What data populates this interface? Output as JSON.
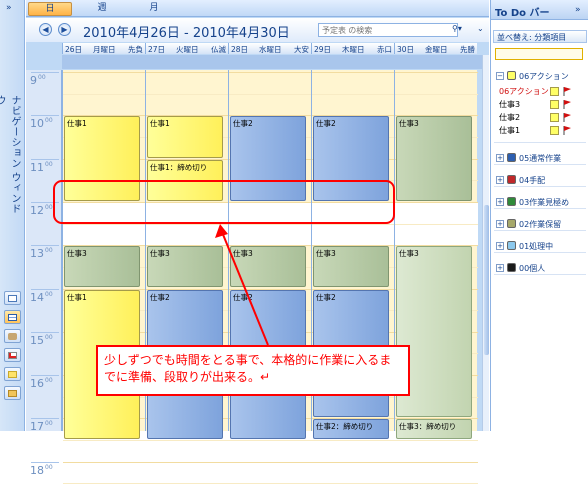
{
  "nav": {
    "label": "ナビゲーション ウィンドウ",
    "chevron": "»",
    "buttons": [
      "mail-icon",
      "calendar-icon",
      "contacts-icon",
      "tasks-icon",
      "notes-icon",
      "folder-icon"
    ]
  },
  "view_tabs": [
    "日",
    "週",
    "月"
  ],
  "active_tab": "週",
  "date_range": "2010年4月26日 - 2010年4月30日",
  "search": {
    "placeholder": "予定表 の検索"
  },
  "days": [
    {
      "num": "26日",
      "weekday": "月曜日",
      "rokuyo": "先負"
    },
    {
      "num": "27日",
      "weekday": "火曜日",
      "rokuyo": "仏滅"
    },
    {
      "num": "28日",
      "weekday": "水曜日",
      "rokuyo": "大安"
    },
    {
      "num": "29日",
      "weekday": "木曜日",
      "rokuyo": "赤口"
    },
    {
      "num": "30日",
      "weekday": "金曜日",
      "rokuyo": "先勝"
    }
  ],
  "hours": [
    "9",
    "10",
    "11",
    "12",
    "13",
    "14",
    "15",
    "16",
    "17",
    "18"
  ],
  "hour_suffix": "00",
  "appointments": [
    {
      "day": 0,
      "start": 10.0,
      "end": 12.0,
      "label": "仕事1",
      "color": "yellow"
    },
    {
      "day": 0,
      "start": 13.0,
      "end": 14.0,
      "label": "仕事3",
      "color": "green"
    },
    {
      "day": 0,
      "start": 14.0,
      "end": 17.5,
      "label": "仕事1",
      "color": "yellow"
    },
    {
      "day": 1,
      "start": 10.0,
      "end": 11.0,
      "label": "仕事1",
      "color": "yellow"
    },
    {
      "day": 1,
      "start": 11.0,
      "end": 12.0,
      "label": "仕事1：締め切り",
      "color": "yellow"
    },
    {
      "day": 1,
      "start": 13.0,
      "end": 14.0,
      "label": "仕事3",
      "color": "green"
    },
    {
      "day": 1,
      "start": 14.0,
      "end": 17.5,
      "label": "仕事2",
      "color": "blue"
    },
    {
      "day": 2,
      "start": 10.0,
      "end": 12.0,
      "label": "仕事2",
      "color": "blue"
    },
    {
      "day": 2,
      "start": 13.0,
      "end": 14.0,
      "label": "仕事3",
      "color": "green"
    },
    {
      "day": 2,
      "start": 14.0,
      "end": 17.5,
      "label": "仕事2",
      "color": "blue"
    },
    {
      "day": 3,
      "start": 10.0,
      "end": 12.0,
      "label": "仕事2",
      "color": "blue"
    },
    {
      "day": 3,
      "start": 13.0,
      "end": 14.0,
      "label": "仕事3",
      "color": "green"
    },
    {
      "day": 3,
      "start": 14.0,
      "end": 17.0,
      "label": "仕事2",
      "color": "blue"
    },
    {
      "day": 3,
      "start": 17.0,
      "end": 17.5,
      "label": "仕事2：締め切り",
      "color": "blue"
    },
    {
      "day": 4,
      "start": 10.0,
      "end": 12.0,
      "label": "仕事3",
      "color": "green"
    },
    {
      "day": 4,
      "start": 13.0,
      "end": 17.0,
      "label": "仕事3",
      "color": "greenlight"
    },
    {
      "day": 4,
      "start": 17.0,
      "end": 17.5,
      "label": "仕事3：締め切り",
      "color": "greenlight"
    }
  ],
  "annotation": {
    "text": "少しずつでも時間をとる事で、本格的に作業に入るまでに準備、段取りが出来る。↵"
  },
  "todo": {
    "title": "To Do バー",
    "chevron": "»",
    "sort_label": "並べ替え: 分類項目",
    "groups": [
      {
        "label": "06アクション",
        "color": "#ffff66",
        "expand": "−"
      },
      {
        "label": "05通常作業",
        "color": "#2d5fb0",
        "expand": "+"
      },
      {
        "label": "04手配",
        "color": "#c0282a",
        "expand": "+"
      },
      {
        "label": "03作業見極め",
        "color": "#2f8a3a",
        "expand": "+"
      },
      {
        "label": "02作業保留",
        "color": "#a6a86a",
        "expand": "+"
      },
      {
        "label": "01処理中",
        "color": "#8cc8ec",
        "expand": "+"
      },
      {
        "label": "00個人",
        "color": "#1a1a1a",
        "expand": "+"
      }
    ],
    "tasks_header": "06アクション",
    "tasks": [
      "仕事3",
      "仕事2",
      "仕事1"
    ]
  }
}
